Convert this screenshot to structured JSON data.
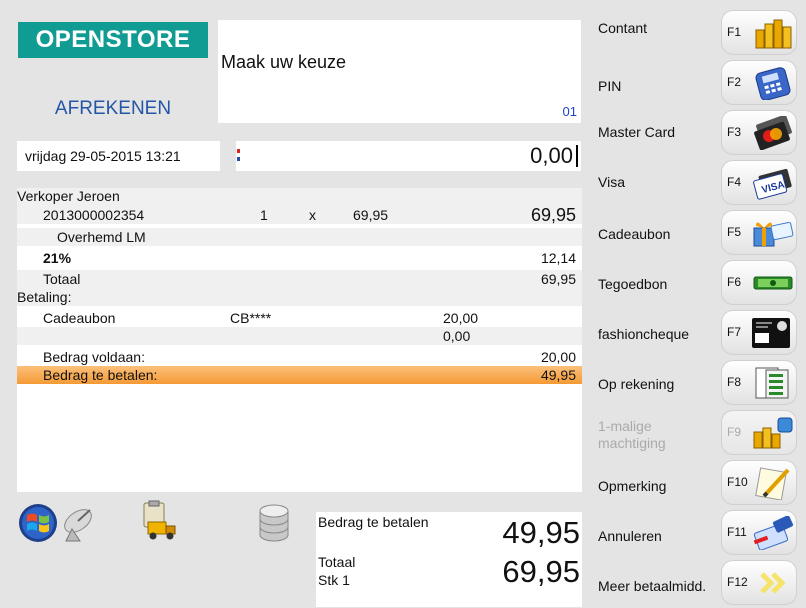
{
  "header": {
    "logo_text": "OPENSTORE",
    "mode_title": "AFREKENEN",
    "message": "Maak uw keuze",
    "message_code": "01",
    "datetime": "vrijdag 29-05-2015 13:21",
    "amount_input": "0,00"
  },
  "receipt": {
    "seller": "Verkoper Jeroen",
    "item": {
      "code": "2013000002354",
      "qty": "1",
      "times": "x",
      "unit_price": "69,95",
      "total": "69,95",
      "description": "Overhemd LM"
    },
    "vat": {
      "rate": "21%",
      "amount": "12,14"
    },
    "total": {
      "label": "Totaal",
      "amount": "69,95"
    },
    "payment_header": "Betaling:",
    "payments": [
      {
        "type": "Cadeaubon",
        "ref": "CB****",
        "amount": "20,00"
      },
      {
        "type": "",
        "ref": "",
        "amount": "0,00"
      }
    ],
    "paid": {
      "label": "Bedrag voldaan:",
      "amount": "20,00"
    },
    "due": {
      "label": "Bedrag te betalen:",
      "amount": "49,95"
    }
  },
  "summary": {
    "due_label": "Bedrag te betalen",
    "due_amount": "49,95",
    "total_label": "Totaal",
    "count_label": "Stk  1",
    "total_amount": "69,95"
  },
  "payment_methods": [
    {
      "label": "Contant",
      "key": "F1",
      "icon": "coins-icon",
      "enabled": true
    },
    {
      "label": "PIN",
      "key": "F2",
      "icon": "card-terminal-icon",
      "enabled": true
    },
    {
      "label": "Master Card",
      "key": "F3",
      "icon": "mastercard-icon",
      "enabled": true
    },
    {
      "label": "Visa",
      "key": "F4",
      "icon": "visa-icon",
      "enabled": true
    },
    {
      "label": "Cadeaubon",
      "key": "F5",
      "icon": "gift-card-icon",
      "enabled": true
    },
    {
      "label": "Tegoedbon",
      "key": "F6",
      "icon": "credit-voucher-icon",
      "enabled": true
    },
    {
      "label": "fashioncheque",
      "key": "F7",
      "icon": "fashioncheque-icon",
      "enabled": true
    },
    {
      "label": "Op rekening",
      "key": "F8",
      "icon": "invoice-icon",
      "enabled": true
    },
    {
      "label": "1-malige machtiging",
      "key": "F9",
      "icon": "phone-coins-icon",
      "enabled": false
    },
    {
      "label": "Opmerking",
      "key": "F10",
      "icon": "note-pencil-icon",
      "enabled": true
    },
    {
      "label": "Annuleren",
      "key": "F11",
      "icon": "cancel-card-icon",
      "enabled": true
    },
    {
      "label": "Meer betaalmidd.",
      "key": "F12",
      "icon": "double-chevron-right-icon",
      "enabled": true
    }
  ],
  "toolbar_icons": [
    "windows-logo-icon",
    "satellite-dish-icon",
    "delivery-truck-icon",
    "database-icon"
  ],
  "colors": {
    "logo_bg": "#119c93",
    "mode_title": "#2356a8",
    "highlight": "#f49a35",
    "message_code": "#1c44c8"
  }
}
